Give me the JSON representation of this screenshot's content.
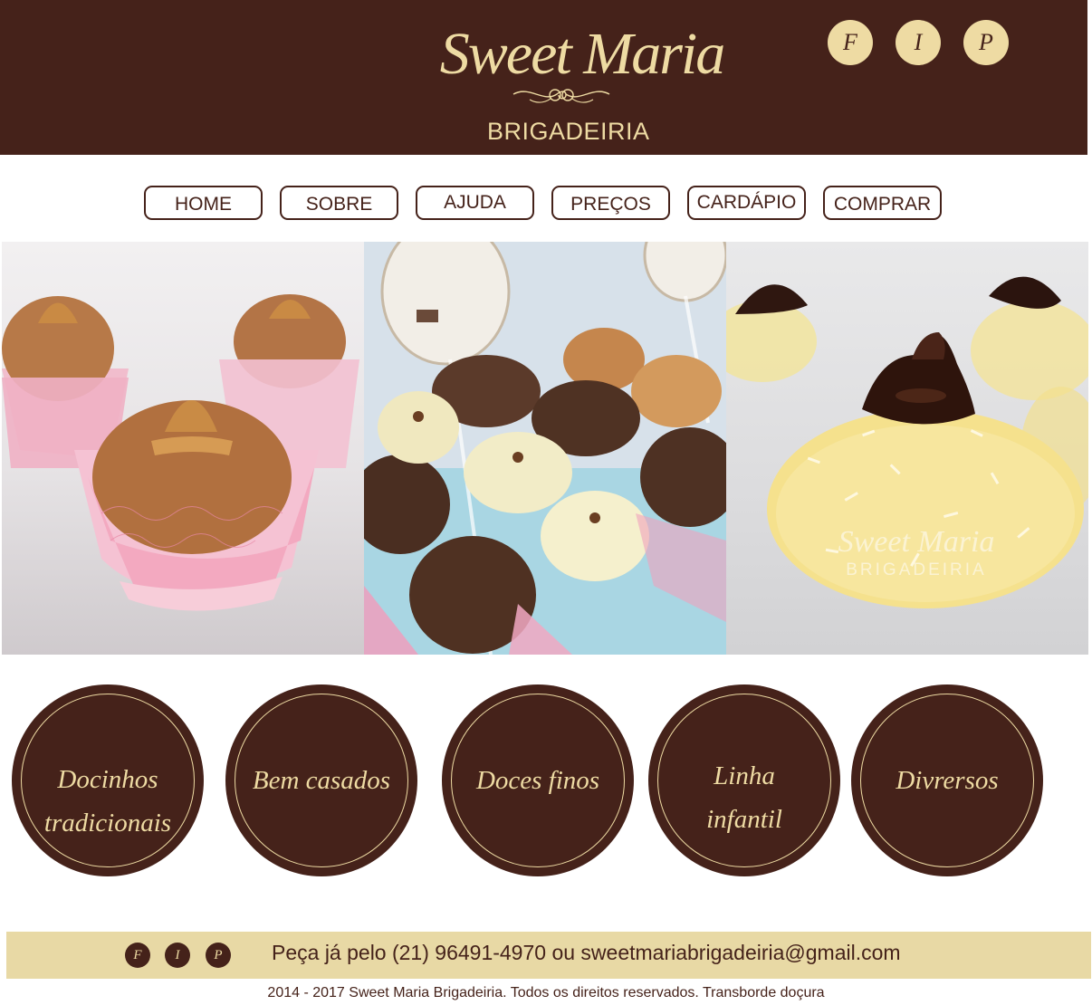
{
  "header": {
    "logo_script": "Sweet Maria",
    "logo_sub": "BRIGADEIRIA",
    "social": [
      {
        "letter": "F",
        "icon": "facebook-icon"
      },
      {
        "letter": "I",
        "icon": "instagram-icon"
      },
      {
        "letter": "P",
        "icon": "pinterest-icon"
      }
    ]
  },
  "nav": {
    "items": [
      "HOME",
      "SOBRE",
      "AJUDA",
      "PREÇOS",
      "CARDÁPIO",
      "COMPRAR"
    ]
  },
  "gallery": {
    "photos": [
      {
        "subject": "doce de leite brigadeiros in pink lace cups"
      },
      {
        "subject": "assorted brigadeiros and beijinhos on display"
      },
      {
        "subject": "coconut beijinho with chocolate topping"
      }
    ],
    "watermark_script": "Sweet Maria",
    "watermark_sub": "BRIGADEIRIA"
  },
  "categories": [
    "Docinhos\ntradicionais",
    "Bem casados",
    "Doces finos",
    "Linha\ninfantil",
    "Divrersos"
  ],
  "footer": {
    "social": [
      "F",
      "I",
      "P"
    ],
    "contact": "Peça já pelo (21) 96491-4970 ou sweetmariabrigadeiria@gmail.com",
    "copyright": "2014 - 2017 Sweet Maria Brigadeiria. Todos os direitos reservados. Transborde doçura"
  },
  "colors": {
    "brown": "#45221a",
    "cream": "#eedba3",
    "footer_bar": "#e8d9a5"
  }
}
